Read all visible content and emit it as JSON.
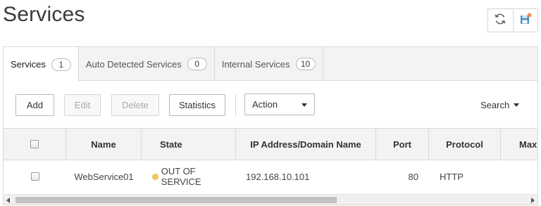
{
  "page": {
    "title": "Services"
  },
  "top_actions": [
    {
      "icon": "refresh-icon"
    },
    {
      "icon": "save-icon",
      "badge_color": "#f08a5d"
    }
  ],
  "tabs": [
    {
      "label": "Services",
      "count": "1",
      "active": true
    },
    {
      "label": "Auto Detected Services",
      "count": "0",
      "active": false
    },
    {
      "label": "Internal Services",
      "count": "10",
      "active": false
    }
  ],
  "toolbar": {
    "add_label": "Add",
    "edit_label": "Edit",
    "delete_label": "Delete",
    "statistics_label": "Statistics",
    "action_label": "Action",
    "search_label": "Search"
  },
  "table": {
    "columns": [
      "Name",
      "State",
      "IP Address/Domain Name",
      "Port",
      "Protocol",
      "Max"
    ],
    "rows": [
      {
        "name": "WebService01",
        "state": "OUT OF SERVICE",
        "state_color": "#f2c45d",
        "ip": "192.168.10.101",
        "port": "80",
        "protocol": "HTTP",
        "max": ""
      }
    ]
  },
  "scrollbar": {
    "position_fraction": 0.0,
    "visible_fraction": 0.6
  }
}
